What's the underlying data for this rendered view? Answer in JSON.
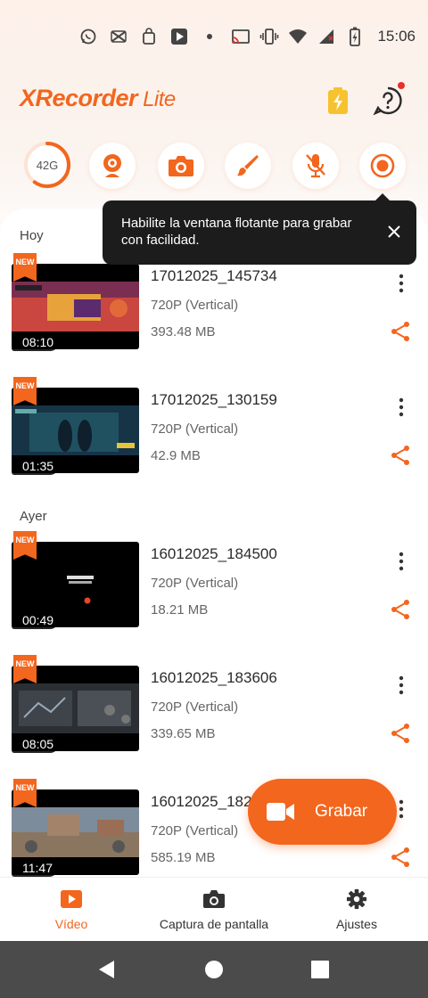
{
  "status_bar": {
    "time": "15:06",
    "left_icons": [
      "whatsapp-icon",
      "capcut-icon",
      "shopping-bag-icon",
      "play-store-icon",
      "dot-icon"
    ],
    "right_icons": [
      "cast-icon",
      "vibrate-icon",
      "wifi-icon",
      "signal-icon",
      "battery-charging-icon"
    ]
  },
  "header": {
    "app_name": "XRecorder",
    "app_suffix": "Lite"
  },
  "tools": {
    "storage_label": "42G",
    "storage_fraction": 0.6,
    "buttons": [
      "webcam-icon",
      "camera-icon",
      "brush-icon",
      "mic-off-icon",
      "record-icon"
    ]
  },
  "tooltip": {
    "text": "Habilite la ventana flotante para grabar con facilidad."
  },
  "sections": [
    {
      "label": "Hoy",
      "items": [
        {
          "title": "17012025_145734",
          "resolution": "720P (Vertical)",
          "size": "393.48 MB",
          "duration": "08:10",
          "badge": "NEW"
        },
        {
          "title": "17012025_130159",
          "resolution": "720P (Vertical)",
          "size": "42.9 MB",
          "duration": "01:35",
          "badge": "NEW"
        }
      ]
    },
    {
      "label": "Ayer",
      "items": [
        {
          "title": "16012025_184500",
          "resolution": "720P (Vertical)",
          "size": "18.21 MB",
          "duration": "00:49",
          "badge": "NEW"
        },
        {
          "title": "16012025_183606",
          "resolution": "720P (Vertical)",
          "size": "339.65 MB",
          "duration": "08:05",
          "badge": "NEW"
        },
        {
          "title": "16012025_182",
          "resolution": "720P (Vertical)",
          "size": "585.19 MB",
          "duration": "11:47",
          "badge": "NEW"
        }
      ]
    }
  ],
  "fab": {
    "label": "Grabar"
  },
  "bottom_nav": {
    "video": "Vídeo",
    "screenshot": "Captura de pantalla",
    "settings": "Ajustes"
  },
  "colors": {
    "accent": "#f2661e",
    "tooltip_bg": "#1c1c1c",
    "system_nav": "#4b4b4b"
  }
}
